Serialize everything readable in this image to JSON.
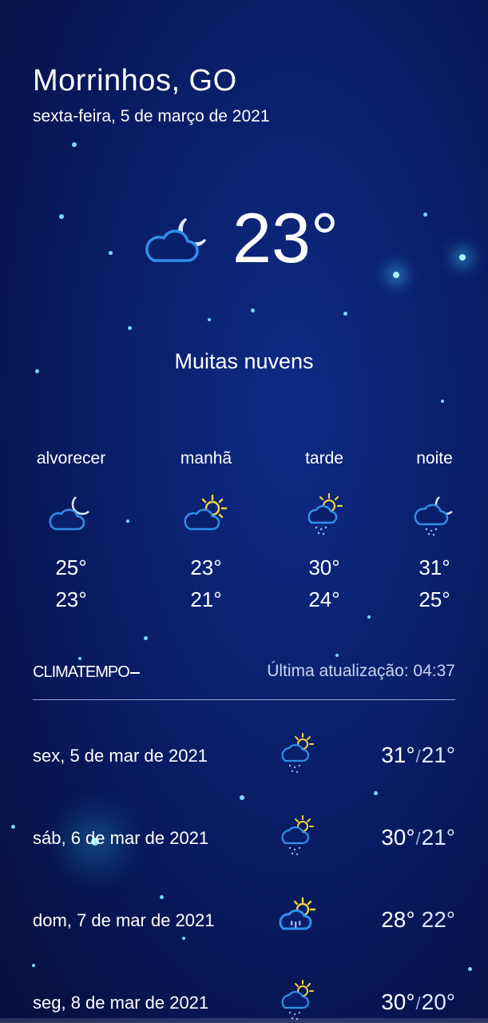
{
  "location": {
    "city": "Morrinhos, GO",
    "date": "sexta-feira, 5 de março de 2021"
  },
  "current": {
    "icon": "cloud-moon-icon",
    "temperature": "23°",
    "condition": "Muitas nuvens"
  },
  "periods": [
    {
      "label": "alvorecer",
      "icon": "cloud-moon-icon",
      "max": "25°",
      "min": "23°"
    },
    {
      "label": "manhã",
      "icon": "cloud-sun-icon",
      "max": "23°",
      "min": "21°"
    },
    {
      "label": "tarde",
      "icon": "cloud-sun-rain-icon",
      "max": "30°",
      "min": "24°"
    },
    {
      "label": "noite",
      "icon": "cloud-moon-rain-icon",
      "max": "31°",
      "min": "25°"
    }
  ],
  "provider": {
    "brand": "CLIMATEMPO",
    "last_update": "Última atualização: 04:37"
  },
  "daily": [
    {
      "date": "sex, 5 de mar de 2021",
      "icon": "cloud-sun-rain-icon",
      "max": "31°",
      "min": "21°"
    },
    {
      "date": "sáb, 6 de mar de 2021",
      "icon": "cloud-sun-rain-icon",
      "max": "30°",
      "min": "21°"
    },
    {
      "date": "dom, 7 de mar de 2021",
      "icon": "cloud-sun-heavy-rain-icon",
      "max": "28°",
      "min": "22°"
    },
    {
      "date": "seg, 8 de mar de 2021",
      "icon": "cloud-sun-rain-icon",
      "max": "30°",
      "min": "20°"
    }
  ],
  "colors": {
    "background_top": "#0a1f6b",
    "background_bottom": "#050f3c",
    "cloud_stroke": "#2f8fe8",
    "moon_stroke": "#dfe6f5",
    "sun": "#f5d33c",
    "rain": "#8fb8ff"
  }
}
